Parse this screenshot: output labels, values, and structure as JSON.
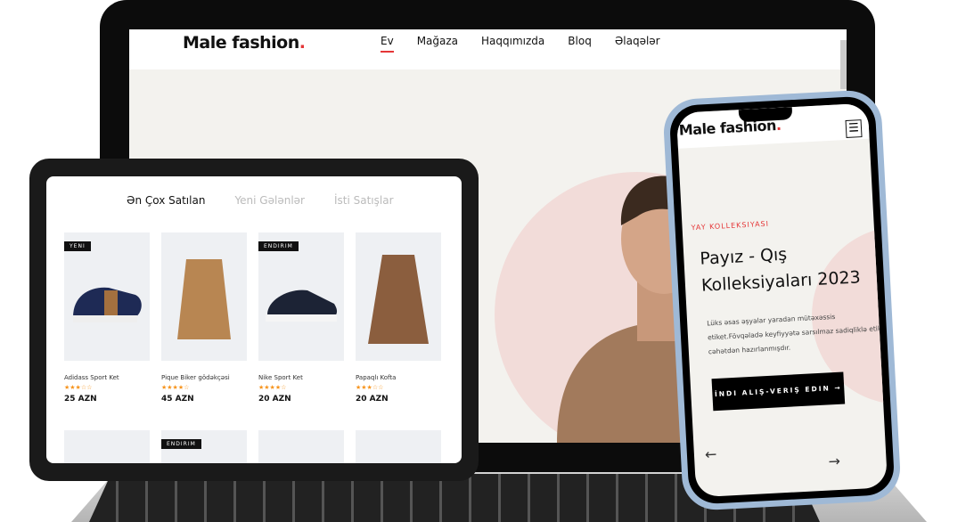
{
  "brand": {
    "logo": "Male fashion",
    "logo_dot": ".",
    "accent": "#e53637"
  },
  "desktop": {
    "nav": [
      {
        "label": "Ev",
        "active": true
      },
      {
        "label": "Mağaza"
      },
      {
        "label": "Haqqımızda"
      },
      {
        "label": "Bloq"
      },
      {
        "label": "Əlaqələr"
      }
    ]
  },
  "tablet": {
    "tabs": [
      {
        "label": "Ən Çox Satılan",
        "active": true
      },
      {
        "label": "Yeni Gələnlər"
      },
      {
        "label": "İsti Satışlar"
      }
    ],
    "products": [
      {
        "name": "Adidass Sport Ket",
        "badge": "YENI",
        "stars": "★★★☆☆",
        "rating": 3,
        "price": "25 AZN"
      },
      {
        "name": "Pique Biker gödəkçəsi",
        "badge": "",
        "stars": "★★★★☆",
        "rating": 4,
        "price": "45 AZN"
      },
      {
        "name": "Nike Sport Ket",
        "badge": "ENDIRIM",
        "stars": "★★★★☆",
        "rating": 4,
        "price": "20 AZN"
      },
      {
        "name": "Papaqlı Kofta",
        "badge": "",
        "stars": "★★★☆☆",
        "rating": 3,
        "price": "20 AZN"
      }
    ],
    "row2_badge": "ENDIRIM"
  },
  "phone": {
    "kicker": "YAY KOLLEKSIYASI",
    "title": "Payız - Qış Kolleksiyaları 2023",
    "description": "Lüks əsas əşyalar yaradan mütəxəssis etiket.Fövqəladə keyfiyyətə sarsılmaz sadiqliklə etik cəhətdən hazırlanmışdır.",
    "button": "İNDI ALIŞ-VERIŞ EDIN →",
    "prev": "←",
    "next": "→",
    "menu_icon": "☰"
  }
}
